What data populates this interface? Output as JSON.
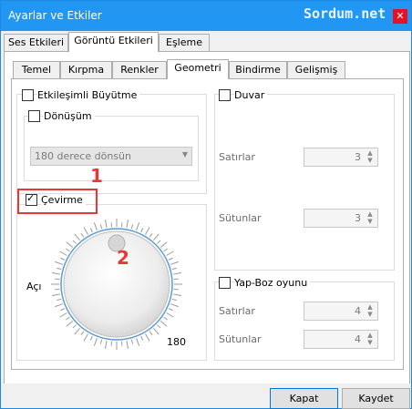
{
  "window": {
    "title": "Ayarlar ve Etkiler",
    "watermark": "Sordum.net",
    "close_glyph": "✕"
  },
  "outer_tabs": [
    {
      "label": "Ses Etkileri"
    },
    {
      "label": "Görüntü Etkileri"
    },
    {
      "label": "Eşleme"
    }
  ],
  "inner_tabs": [
    {
      "label": "Temel"
    },
    {
      "label": "Kırpma"
    },
    {
      "label": "Renkler"
    },
    {
      "label": "Geometri"
    },
    {
      "label": "Bindirme"
    },
    {
      "label": "Gelişmiş"
    }
  ],
  "left": {
    "interactive_zoom": {
      "label": "Etkileşimli Büyütme",
      "checked": false
    },
    "rotation": {
      "label": "Dönüşüm",
      "checked": false,
      "combo_value": "180 derece dönsün"
    },
    "transform": {
      "label": "Çevirme",
      "checked": true
    },
    "angle_label": "Açı",
    "angle_value": "180",
    "annotation_1": "1",
    "annotation_2": "2"
  },
  "right": {
    "wall": {
      "label": "Duvar",
      "checked": false,
      "rows_label": "Satırlar",
      "rows_value": "3",
      "cols_label": "Sütunlar",
      "cols_value": "3"
    },
    "puzzle": {
      "label": "Yap-Boz oyunu",
      "checked": false,
      "rows_label": "Satırlar",
      "rows_value": "4",
      "cols_label": "Sütunlar",
      "cols_value": "4"
    }
  },
  "footer": {
    "close_label": "Kapat",
    "save_label": "Kaydet"
  },
  "colors": {
    "titlebar": "#2196f3",
    "annotation": "#e53935",
    "close": "#e81123"
  }
}
